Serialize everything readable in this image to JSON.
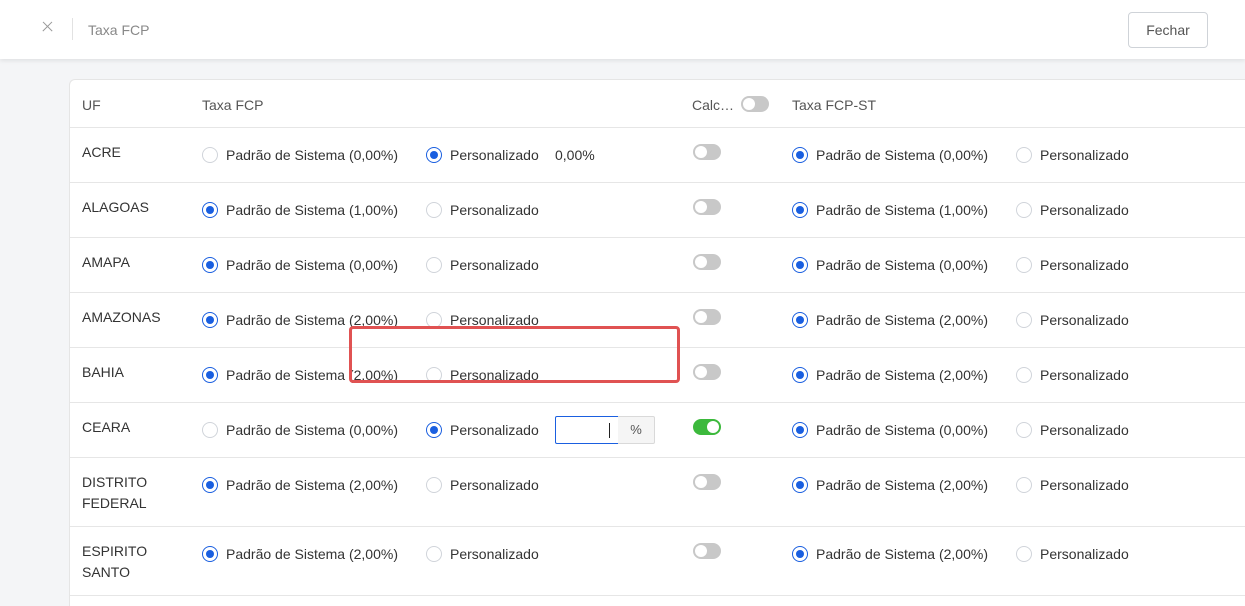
{
  "topbar": {
    "title": "Taxa FCP",
    "close_button_label": "Fechar"
  },
  "table": {
    "headers": {
      "uf": "UF",
      "taxa_fcp": "Taxa FCP",
      "calc": "Calc…",
      "taxa_fcp_st": "Taxa FCP-ST"
    },
    "calc_header_toggle_on": false,
    "rows": [
      {
        "uf": "ACRE",
        "fcp_padrao": "Padrão de Sistema (0,00%)",
        "fcp_personalizado": "Personalizado",
        "fcp_selected": "personalizado",
        "fcp_value": "0,00%",
        "calc_on": false,
        "st_padrao": "Padrão de Sistema (0,00%)",
        "st_personalizado": "Personalizado",
        "st_selected": "padrao"
      },
      {
        "uf": "ALAGOAS",
        "fcp_padrao": "Padrão de Sistema (1,00%)",
        "fcp_personalizado": "Personalizado",
        "fcp_selected": "padrao",
        "calc_on": false,
        "st_padrao": "Padrão de Sistema (1,00%)",
        "st_personalizado": "Personalizado",
        "st_selected": "padrao"
      },
      {
        "uf": "AMAPA",
        "fcp_padrao": "Padrão de Sistema (0,00%)",
        "fcp_personalizado": "Personalizado",
        "fcp_selected": "padrao",
        "calc_on": false,
        "st_padrao": "Padrão de Sistema (0,00%)",
        "st_personalizado": "Personalizado",
        "st_selected": "padrao"
      },
      {
        "uf": "AMAZONAS",
        "fcp_padrao": "Padrão de Sistema (2,00%)",
        "fcp_personalizado": "Personalizado",
        "fcp_selected": "padrao",
        "calc_on": false,
        "st_padrao": "Padrão de Sistema (2,00%)",
        "st_personalizado": "Personalizado",
        "st_selected": "padrao"
      },
      {
        "uf": "BAHIA",
        "fcp_padrao": "Padrão de Sistema (2,00%)",
        "fcp_personalizado": "Personalizado",
        "fcp_selected": "padrao",
        "calc_on": false,
        "st_padrao": "Padrão de Sistema (2,00%)",
        "st_personalizado": "Personalizado",
        "st_selected": "padrao"
      },
      {
        "uf": "CEARA",
        "fcp_padrao": "Padrão de Sistema (0,00%)",
        "fcp_personalizado": "Personalizado",
        "fcp_selected": "personalizado",
        "fcp_input_value": "",
        "fcp_input_suffix": "%",
        "calc_on": true,
        "st_padrao": "Padrão de Sistema (0,00%)",
        "st_personalizado": "Personalizado",
        "st_selected": "padrao"
      },
      {
        "uf": "DISTRITO FEDERAL",
        "fcp_padrao": "Padrão de Sistema (2,00%)",
        "fcp_personalizado": "Personalizado",
        "fcp_selected": "padrao",
        "calc_on": false,
        "st_padrao": "Padrão de Sistema (2,00%)",
        "st_personalizado": "Personalizado",
        "st_selected": "padrao"
      },
      {
        "uf": "ESPIRITO SANTO",
        "fcp_padrao": "Padrão de Sistema (2,00%)",
        "fcp_personalizado": "Personalizado",
        "fcp_selected": "padrao",
        "calc_on": false,
        "st_padrao": "Padrão de Sistema (2,00%)",
        "st_personalizado": "Personalizado",
        "st_selected": "padrao"
      }
    ]
  },
  "colors": {
    "accent": "#1a5fe0",
    "toggle_on": "#3cb93c",
    "highlight": "#e05252"
  }
}
